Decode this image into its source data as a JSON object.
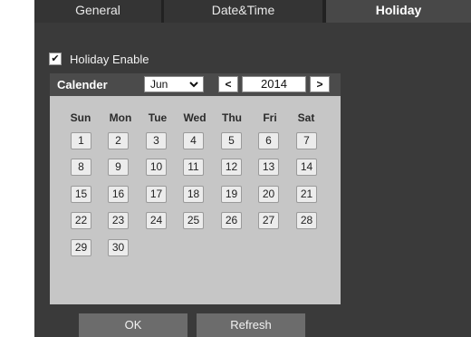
{
  "tabs": [
    "General",
    "Date&Time",
    "Holiday"
  ],
  "holiday_enable": {
    "label": "Holiday Enable",
    "checked": true
  },
  "calendar": {
    "title": "Calender",
    "month": "Jun",
    "year": "2014",
    "prev": "<",
    "next": ">",
    "weekdays": [
      "Sun",
      "Mon",
      "Tue",
      "Wed",
      "Thu",
      "Fri",
      "Sat"
    ],
    "days": [
      [
        "1",
        "2",
        "3",
        "4",
        "5",
        "6",
        "7"
      ],
      [
        "8",
        "9",
        "10",
        "11",
        "12",
        "13",
        "14"
      ],
      [
        "15",
        "16",
        "17",
        "18",
        "19",
        "20",
        "21"
      ],
      [
        "22",
        "23",
        "24",
        "25",
        "26",
        "27",
        "28"
      ],
      [
        "29",
        "30"
      ]
    ]
  },
  "buttons": {
    "ok": "OK",
    "refresh": "Refresh"
  },
  "colors": {
    "panel": "#3a3a3a",
    "calendar_bg": "#c6c6c6",
    "active_tab": "#484848"
  }
}
